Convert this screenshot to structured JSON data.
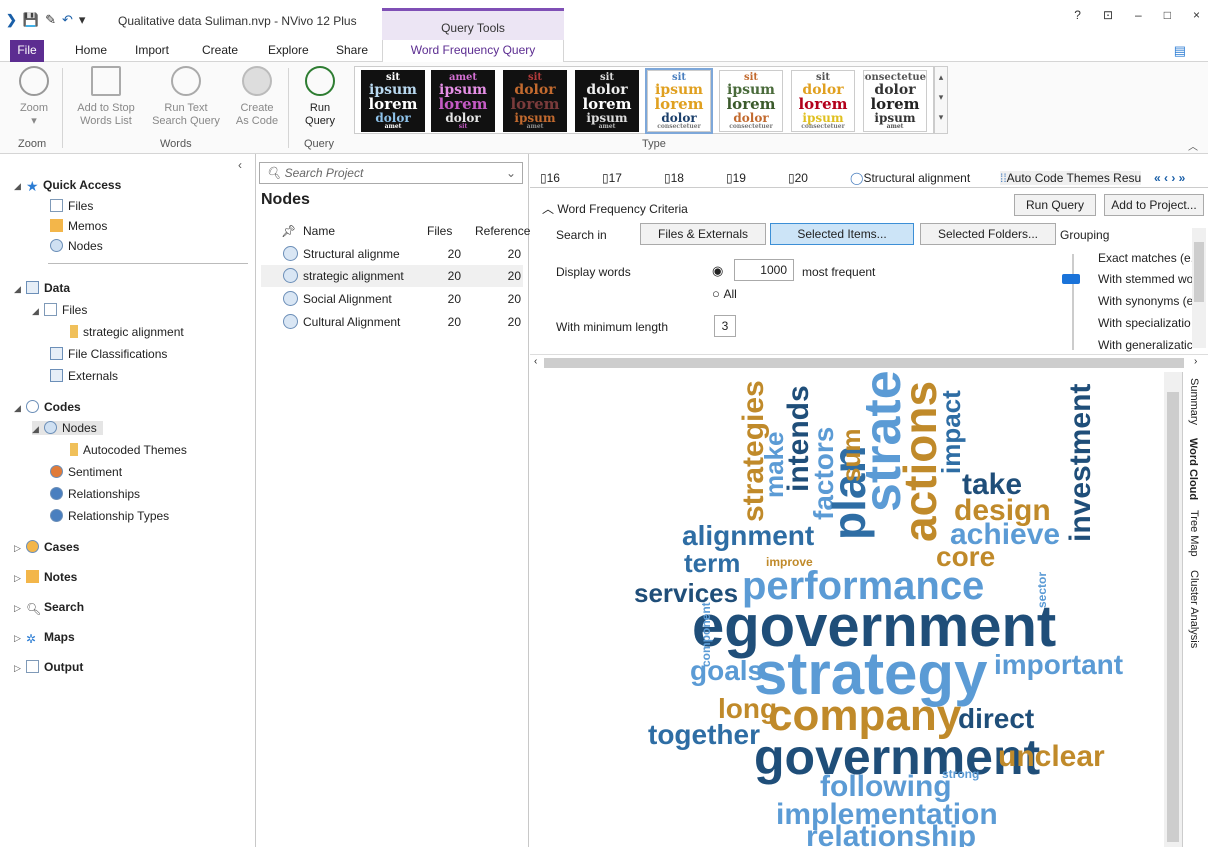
{
  "titlebar": {
    "title": "Qualitative data Suliman.nvp - NVivo 12 Plus",
    "context_tab": "Query Tools",
    "help": "?",
    "restore": "⊡",
    "minimize": "–",
    "maximize": "□",
    "close": "×"
  },
  "tabs": {
    "file": "File",
    "home": "Home",
    "import": "Import",
    "create": "Create",
    "explore": "Explore",
    "share": "Share",
    "word_frequency_query": "Word Frequency Query"
  },
  "ribbon": {
    "zoom": "Zoom",
    "add_stop_words": [
      "Add to Stop",
      "Words List"
    ],
    "run_text_search": [
      "Run Text",
      "Search Query"
    ],
    "create_as_code": [
      "Create",
      "As Code"
    ],
    "run_query": [
      "Run",
      "Query"
    ],
    "groups": {
      "zoom": "Zoom",
      "words": "Words",
      "query": "Query",
      "type": "Type"
    },
    "thumbnails": [
      {
        "words": [
          "sit",
          "ipsum",
          "lorem",
          "dolor",
          "amet"
        ],
        "bg": "#111111",
        "colors": [
          "#ffffff",
          "#b9d9f0",
          "#ffffff",
          "#8ec2ea",
          "#ffffff"
        ]
      },
      {
        "words": [
          "amet",
          "ipsum",
          "lorem",
          "dolor",
          "sit"
        ],
        "bg": "#111111",
        "colors": [
          "#d36fd3",
          "#e58fe5",
          "#c45ac4",
          "#e6e6e6",
          "#c45ac4"
        ]
      },
      {
        "words": [
          "sit",
          "dolor",
          "lorem",
          "ipsum",
          "amet"
        ],
        "bg": "#111111",
        "colors": [
          "#b33b3b",
          "#c26a2f",
          "#7a3b3b",
          "#c26a2f",
          "#8f8f8f"
        ]
      },
      {
        "words": [
          "sit",
          "dolor",
          "lorem",
          "ipsum",
          "amet"
        ],
        "bg": "#111111",
        "colors": [
          "#dddddd",
          "#eeeeee",
          "#ffffff",
          "#dddddd",
          "#bbbbbb"
        ]
      },
      {
        "words": [
          "sit",
          "ipsum",
          "lorem",
          "dolor",
          "consectetuer"
        ],
        "bg": "#ffffff",
        "colors": [
          "#4a7fbf",
          "#e0a020",
          "#e0a020",
          "#1b3f6b",
          "#777777"
        ]
      },
      {
        "words": [
          "sit",
          "ipsum",
          "lorem",
          "dolor",
          "consectetuer"
        ],
        "bg": "#ffffff",
        "colors": [
          "#c26a2f",
          "#4a6b3b",
          "#3b5a2b",
          "#c26a2f",
          "#777777"
        ]
      },
      {
        "words": [
          "sit",
          "dolor",
          "lorem",
          "ipsum",
          "consectetuer"
        ],
        "bg": "#ffffff",
        "colors": [
          "#555555",
          "#e0a020",
          "#b3001b",
          "#e0c020",
          "#777777"
        ]
      },
      {
        "words": [
          "consectetuer",
          "dolor",
          "lorem",
          "ipsum",
          "amet"
        ],
        "bg": "#ffffff",
        "colors": [
          "#555555",
          "#333333",
          "#222222",
          "#333333",
          "#555555"
        ]
      }
    ]
  },
  "nav": {
    "quick_access": "Quick Access",
    "qa_files": "Files",
    "qa_memos": "Memos",
    "qa_nodes": "Nodes",
    "data": "Data",
    "data_files": "Files",
    "strategic_alignment": "strategic alignment",
    "file_classifications": "File Classifications",
    "externals": "Externals",
    "codes": "Codes",
    "codes_nodes": "Nodes",
    "autocoded_themes": "Autocoded Themes",
    "sentiment": "Sentiment",
    "relationships": "Relationships",
    "relationship_types": "Relationship Types",
    "cases": "Cases",
    "notes": "Notes",
    "search": "Search",
    "maps": "Maps",
    "output": "Output"
  },
  "middle": {
    "search_placeholder": "Search Project",
    "title": "Nodes",
    "col_name": "Name",
    "col_files": "Files",
    "col_references": "Reference",
    "rows": [
      {
        "name": "Structural alignme",
        "files": "20",
        "references": "20"
      },
      {
        "name": "strategic alignment",
        "files": "20",
        "references": "20"
      },
      {
        "name": "Social Alignment",
        "files": "20",
        "references": "20"
      },
      {
        "name": "Cultural Alignment",
        "files": "20",
        "references": "20"
      }
    ]
  },
  "doc_tabs": [
    "16",
    "17",
    "18",
    "19",
    "20",
    "Structural alignment",
    "Auto Code Themes Resu"
  ],
  "criteria": {
    "title": "Word Frequency Criteria",
    "run_query": "Run Query",
    "add_to_project": "Add to Project...",
    "search_in": "Search in",
    "files_externals": "Files & Externals",
    "selected_items": "Selected Items...",
    "selected_folders": "Selected Folders...",
    "grouping": "Grouping",
    "display_words": "Display words",
    "display_count": "1000",
    "most_frequent": "most frequent",
    "all": "All",
    "min_length_label": "With minimum length",
    "min_length": "3",
    "grouping_options": [
      "Exact matches (e.",
      "With stemmed wo",
      "With synonyms (e",
      "With specializatio",
      "With generalizatic"
    ]
  },
  "side_tabs": [
    "Summary",
    "Word Cloud",
    "Tree Map",
    "Cluster Analysis"
  ],
  "cloud_colors": {
    "dark": "#1f4e79",
    "mid": "#2e6da4",
    "light": "#5b9bd5",
    "gold": "#c08a2a"
  },
  "cloud_words": [
    {
      "text": "strategies",
      "color": "gold",
      "rotate": true
    },
    {
      "text": "make",
      "color": "light",
      "rotate": true
    },
    {
      "text": "intends",
      "color": "dark",
      "rotate": true
    },
    {
      "text": "factors",
      "color": "light",
      "rotate": true
    },
    {
      "text": "plan",
      "color": "mid",
      "rotate": true
    },
    {
      "text": "sum",
      "color": "gold",
      "rotate": true
    },
    {
      "text": "strategic",
      "color": "light",
      "rotate": true
    },
    {
      "text": "actions",
      "color": "gold",
      "rotate": true
    },
    {
      "text": "impact",
      "color": "mid",
      "rotate": true
    },
    {
      "text": "take",
      "color": "dark",
      "rotate": false
    },
    {
      "text": "design",
      "color": "gold",
      "rotate": false
    },
    {
      "text": "alignment",
      "color": "mid",
      "rotate": false
    },
    {
      "text": "achieve",
      "color": "light",
      "rotate": false
    },
    {
      "text": "core",
      "color": "gold",
      "rotate": false
    },
    {
      "text": "investment",
      "color": "dark",
      "rotate": true
    },
    {
      "text": "term",
      "color": "mid",
      "rotate": false
    },
    {
      "text": "improve",
      "color": "gold",
      "rotate": false
    },
    {
      "text": "performance",
      "color": "light",
      "rotate": false
    },
    {
      "text": "sector",
      "color": "light",
      "rotate": true
    },
    {
      "text": "services",
      "color": "dark",
      "rotate": false
    },
    {
      "text": "egovernment",
      "color": "dark",
      "rotate": false
    },
    {
      "text": "component",
      "color": "light",
      "rotate": true
    },
    {
      "text": "goals",
      "color": "light",
      "rotate": false
    },
    {
      "text": "strategy",
      "color": "light",
      "rotate": false
    },
    {
      "text": "important",
      "color": "light",
      "rotate": false
    },
    {
      "text": "long",
      "color": "gold",
      "rotate": false
    },
    {
      "text": "company",
      "color": "gold",
      "rotate": false
    },
    {
      "text": "direct",
      "color": "dark",
      "rotate": false
    },
    {
      "text": "together",
      "color": "mid",
      "rotate": false
    },
    {
      "text": "government",
      "color": "dark",
      "rotate": false
    },
    {
      "text": "unclear",
      "color": "gold",
      "rotate": false
    },
    {
      "text": "following",
      "color": "light",
      "rotate": false
    },
    {
      "text": "strong",
      "color": "light",
      "rotate": false
    },
    {
      "text": "implementation",
      "color": "light",
      "rotate": false
    },
    {
      "text": "relationship",
      "color": "light",
      "rotate": false
    }
  ]
}
